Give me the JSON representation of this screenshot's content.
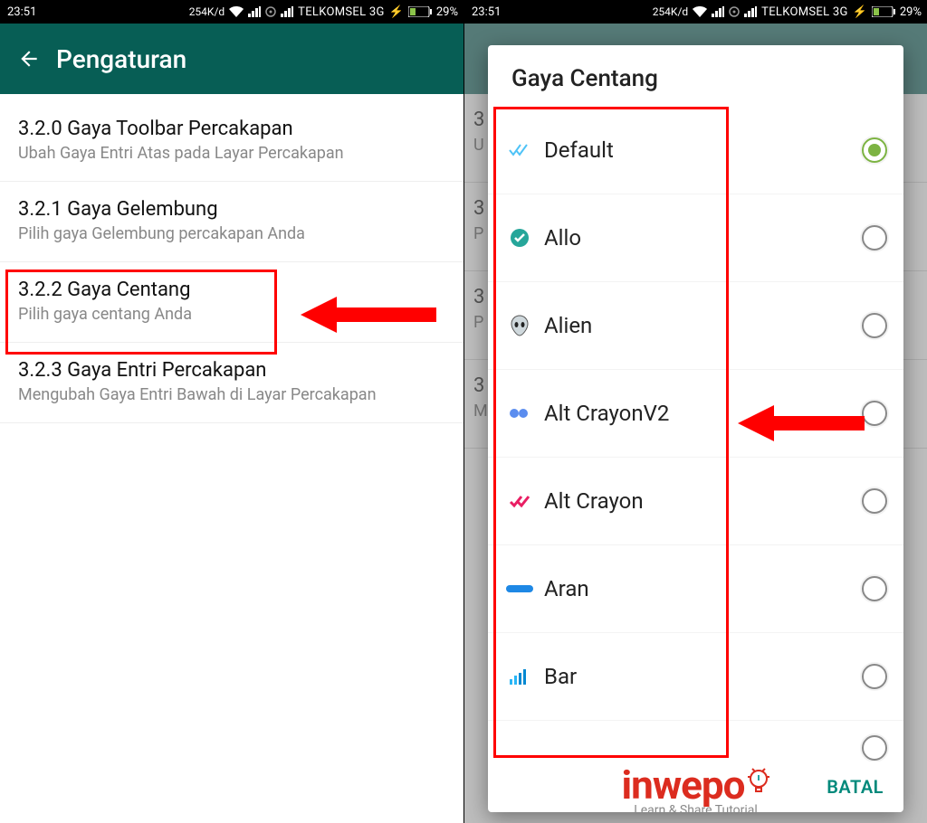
{
  "status": {
    "time": "23:51",
    "net_speed": "254K/d",
    "carrier": "TELKOMSEL 3G",
    "battery_pct": "29%"
  },
  "left": {
    "header_title": "Pengaturan",
    "items": [
      {
        "title": "3.2.0 Gaya Toolbar Percakapan",
        "sub": "Ubah Gaya Entri Atas pada Layar Percakapan"
      },
      {
        "title": "3.2.1 Gaya Gelembung",
        "sub": "Pilih gaya Gelembung percakapan Anda"
      },
      {
        "title": "3.2.2 Gaya Centang",
        "sub": "Pilih gaya centang Anda"
      },
      {
        "title": "3.2.3 Gaya Entri Percakapan",
        "sub": "Mengubah Gaya Entri Bawah di Layar Percakapan"
      }
    ]
  },
  "dialog": {
    "title": "Gaya Centang",
    "cancel": "BATAL",
    "options": [
      {
        "label": "Default",
        "selected": true
      },
      {
        "label": "Allo",
        "selected": false
      },
      {
        "label": "Alien",
        "selected": false
      },
      {
        "label": "Alt CrayonV2",
        "selected": false
      },
      {
        "label": "Alt Crayon",
        "selected": false
      },
      {
        "label": "Aran",
        "selected": false
      },
      {
        "label": "Bar",
        "selected": false
      }
    ]
  },
  "watermark": {
    "brand": "inwepo",
    "tagline": "Learn & Share Tutorial"
  }
}
